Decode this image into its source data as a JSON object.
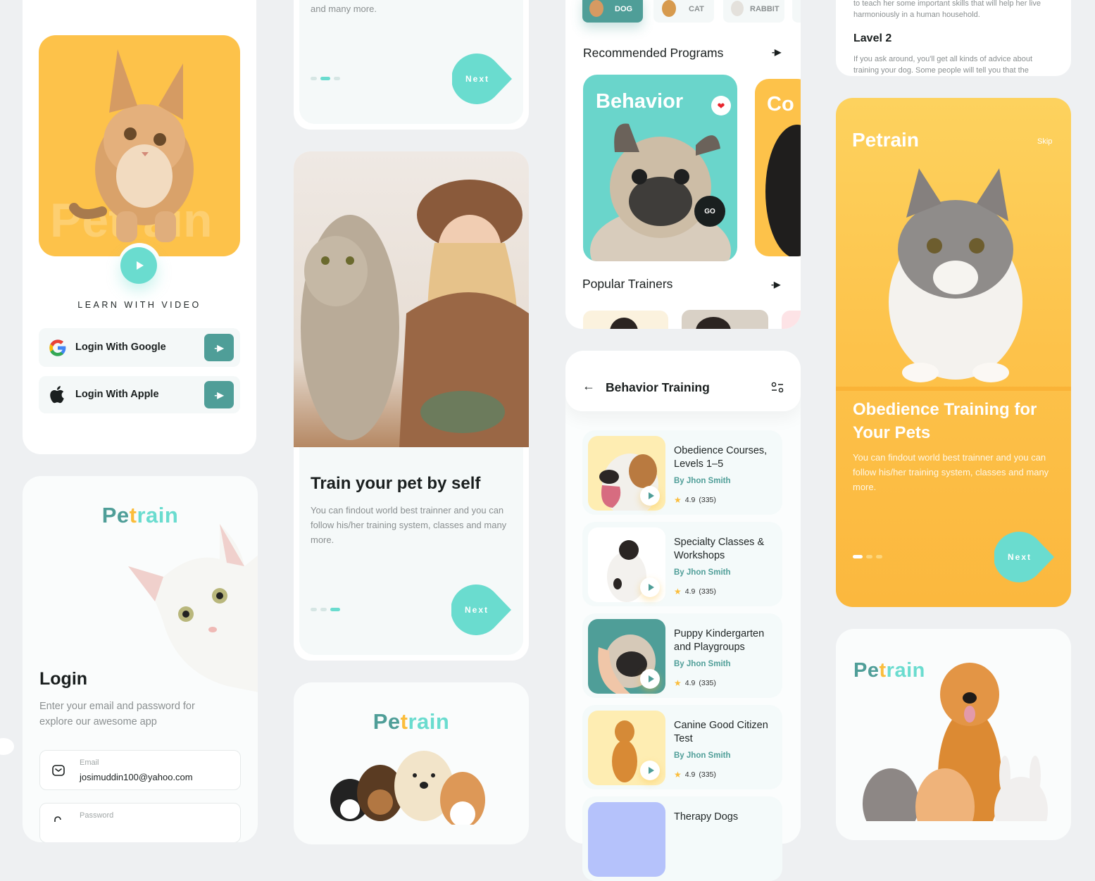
{
  "colors": {
    "teal": "#6adccf",
    "teal_dark": "#4f9e98",
    "yellow": "#fbbd3b",
    "background": "#eef0f2"
  },
  "screen_video_login": {
    "watermark": "Petrain",
    "video_label": "LEARN WITH VIDEO",
    "login_google": "Login With Google",
    "login_apple": "Login With Apple"
  },
  "screen_login": {
    "logo": {
      "p1": "Pe",
      "p2": "t",
      "p3": "rain"
    },
    "title": "Login",
    "subtitle": "Enter your email and password for explore our awesome app",
    "email_label": "Email",
    "email_value": "josimuddin100@yahoo.com",
    "password_label": "Password"
  },
  "screen_onboarding_top": {
    "body_tail": "and many more.",
    "next": "Next",
    "page_index": 2,
    "page_count": 3
  },
  "screen_onboarding_train": {
    "title": "Train your pet by self",
    "body": "You can findout world best trainner and you can follow his/her training system, classes and many more.",
    "next": "Next",
    "page_index": 3,
    "page_count": 3
  },
  "screen_splash_mid": {
    "logo": {
      "p1": "Pe",
      "p2": "t",
      "p3": "rain"
    }
  },
  "screen_home": {
    "categories": [
      {
        "label": "DOG",
        "active": true
      },
      {
        "label": "CAT",
        "active": false
      },
      {
        "label": "RABBIT",
        "active": false
      }
    ],
    "recommended_title": "Recommended Programs",
    "programs": [
      {
        "title": "Behavior",
        "go": "GO",
        "favorite": true
      },
      {
        "title": "Co"
      }
    ],
    "trainers_title": "Popular Trainers"
  },
  "screen_behavior": {
    "title": "Behavior Training",
    "courses": [
      {
        "title": "Obedience Courses, Levels 1–5",
        "by": "By Jhon Smith",
        "rating": "4.9",
        "reviews": "(335)"
      },
      {
        "title": "Specialty Classes & Workshops",
        "by": "By Jhon Smith",
        "rating": "4.9",
        "reviews": "(335)"
      },
      {
        "title": "Puppy Kindergarten and Playgroups",
        "by": "By Jhon Smith",
        "rating": "4.9",
        "reviews": "(335)"
      },
      {
        "title": "Canine Good Citizen Test",
        "by": "By Jhon Smith",
        "rating": "4.9",
        "reviews": "(335)"
      },
      {
        "title": "Therapy Dogs"
      }
    ]
  },
  "screen_detail": {
    "text_top": "to teach her some important skills that will help her live harmoniously in a human household.",
    "level_title": "Lavel 2",
    "level_body": "If you ask around, you'll get all kinds of advice about training your dog. Some people will tell you that the"
  },
  "screen_onboarding_yellow": {
    "brand": "Petrain",
    "skip": "Skip",
    "title": "Obedience Training for Your Pets",
    "body": "You can findout world best trainner and you can follow his/her training system, classes and many more.",
    "next": "Next",
    "page_index": 1,
    "page_count": 3
  },
  "screen_splash_right": {
    "logo": {
      "p1": "Pe",
      "p2": "t",
      "p3": "rain"
    }
  }
}
